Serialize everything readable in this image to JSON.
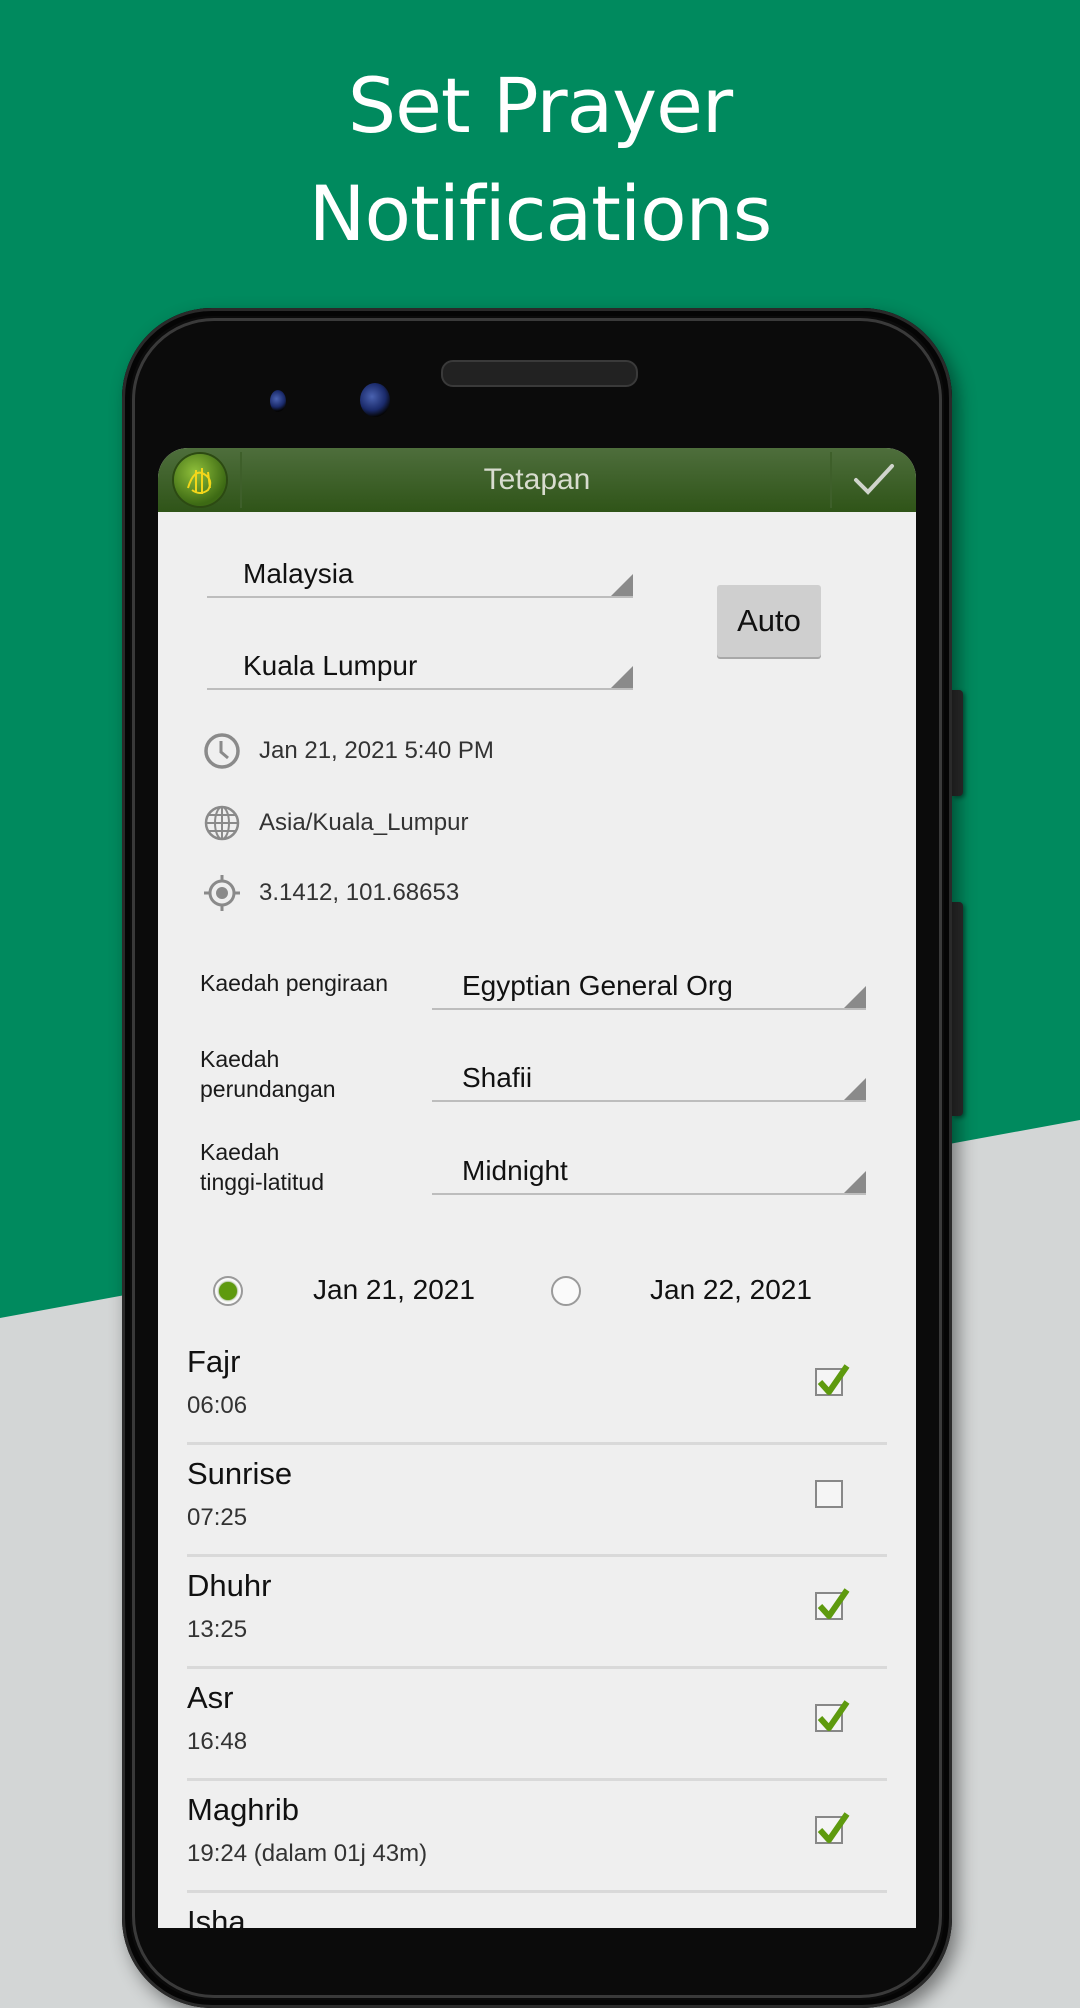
{
  "promo": {
    "title_line1": "Set Prayer",
    "title_line2": "Notifications"
  },
  "colors": {
    "background_top": "#008a5e",
    "background_bottom": "#d3d6d6",
    "appbar": "#3c5f26",
    "accent_green": "#5e9a0e"
  },
  "appbar": {
    "logo_icon": "quran-logo-icon",
    "title": "Tetapan",
    "confirm_icon": "checkmark-icon"
  },
  "location": {
    "country": "Malaysia",
    "city": "Kuala Lumpur",
    "auto_label": "Auto"
  },
  "info": {
    "datetime": "Jan 21, 2021 5:40 PM",
    "timezone": "Asia/Kuala_Lumpur",
    "coordinates": "3.1412, 101.68653"
  },
  "methods": {
    "calc_label": "Kaedah pengiraan",
    "calc_value": "Egyptian General Org",
    "juristic_label_1": "Kaedah",
    "juristic_label_2": "perundangan",
    "juristic_value": "Shafii",
    "highlat_label_1": "Kaedah",
    "highlat_label_2": "tinggi-latitud",
    "highlat_value": "Midnight"
  },
  "dates": {
    "options": [
      {
        "label": "Jan 21, 2021",
        "selected": true
      },
      {
        "label": "Jan 22, 2021",
        "selected": false
      }
    ]
  },
  "prayers": [
    {
      "name": "Fajr",
      "time": "06:06",
      "enabled": true
    },
    {
      "name": "Sunrise",
      "time": "07:25",
      "enabled": false
    },
    {
      "name": "Dhuhr",
      "time": "13:25",
      "enabled": true
    },
    {
      "name": "Asr",
      "time": "16:48",
      "enabled": true
    },
    {
      "name": "Maghrib",
      "time": "19:24 (dalam 01j 43m)",
      "enabled": true
    },
    {
      "name": "Isha",
      "time": "",
      "enabled": null
    }
  ]
}
